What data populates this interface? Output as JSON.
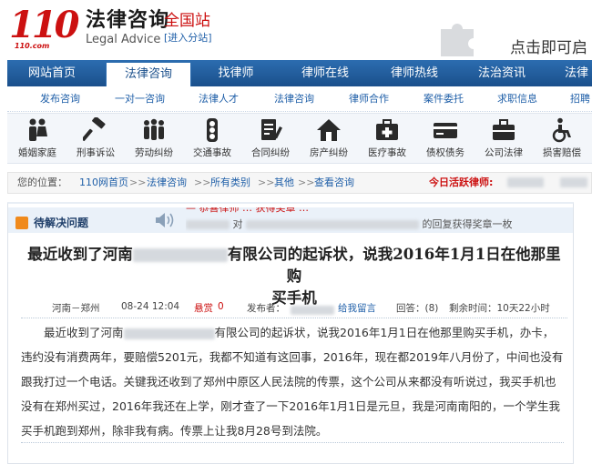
{
  "header": {
    "logo_number": "110",
    "logo_domain": "110.com",
    "brand_name": "法律咨询",
    "brand_en": "Legal Advice",
    "city_name": "全国站",
    "city_switch": "[进入分站]",
    "plugin_notice": "点击即可启"
  },
  "main_nav": [
    "网站首页",
    "法律咨询",
    "找律师",
    "律师在线",
    "律师热线",
    "法治资讯",
    "法律"
  ],
  "main_nav_active": "法律咨询",
  "sub_nav": [
    "发布咨询",
    "一对一咨询",
    "法律人才",
    "法律咨询",
    "律师合作",
    "案件委托",
    "求职信息",
    "招聘"
  ],
  "categories": [
    {
      "label": "婚姻家庭",
      "icon": "family-icon"
    },
    {
      "label": "刑事诉讼",
      "icon": "gavel-icon"
    },
    {
      "label": "劳动纠纷",
      "icon": "workers-icon"
    },
    {
      "label": "交通事故",
      "icon": "traffic-light-icon"
    },
    {
      "label": "合同纠纷",
      "icon": "contract-icon"
    },
    {
      "label": "房产纠纷",
      "icon": "house-icon"
    },
    {
      "label": "医疗事故",
      "icon": "medical-kit-icon"
    },
    {
      "label": "债权债务",
      "icon": "card-icon"
    },
    {
      "label": "公司法律",
      "icon": "briefcase-icon"
    },
    {
      "label": "损害赔偿",
      "icon": "wheelchair-icon"
    }
  ],
  "breadcrumb": {
    "prefix": "您的位置：",
    "items": [
      "110网首页",
      "法律咨询",
      "所有类别",
      "其他",
      "查看咨询"
    ],
    "separator": ">>",
    "active_lawyers_label": "今日活跃律师:"
  },
  "question": {
    "section_label": "待解决问题",
    "ticker_line1": "— 恭喜律师 … 获得奖章 …",
    "ticker_line2_a": "对",
    "ticker_line2_b": "的回复获得奖章一枚",
    "title_part1": "最近收到了河南",
    "title_part2": "有限公司的起诉状，说我2016年1月1日在他那里购",
    "title_line2": "买手机",
    "location": "河南－郑州",
    "date": "08-24 12:04",
    "reward_label": "悬赏",
    "reward_value": "0",
    "poster_label": "发布者：",
    "leave_message": "给我留言",
    "replies": "回答：(8)",
    "time_left": "剩余时间：10天22小时",
    "body_part1": "最近收到了河南",
    "body_part2": "有限公司的起诉状，说我2016年1月1日在他那里购买手机，办卡，违约没有消费两年，要赔偿5201元，我都不知道有这回事，2016年，现在都2019年八月份了，中间也没有跟我打过一个电话。关键我还收到了郑州中原区人民法院的传票，这个公司从来都没有听说过，我买手机也没有在郑州买过，2016年我还在上学，刚才查了一下2016年1月1日是元旦，我是河南南阳的，一个学生我买手机跑到郑州，除非我有病。传票上让我8月28号到法院。"
  },
  "colors": {
    "nav_blue": "#1a4f8b",
    "brand_red": "#cc1010",
    "link_blue": "#1f5fa8"
  }
}
